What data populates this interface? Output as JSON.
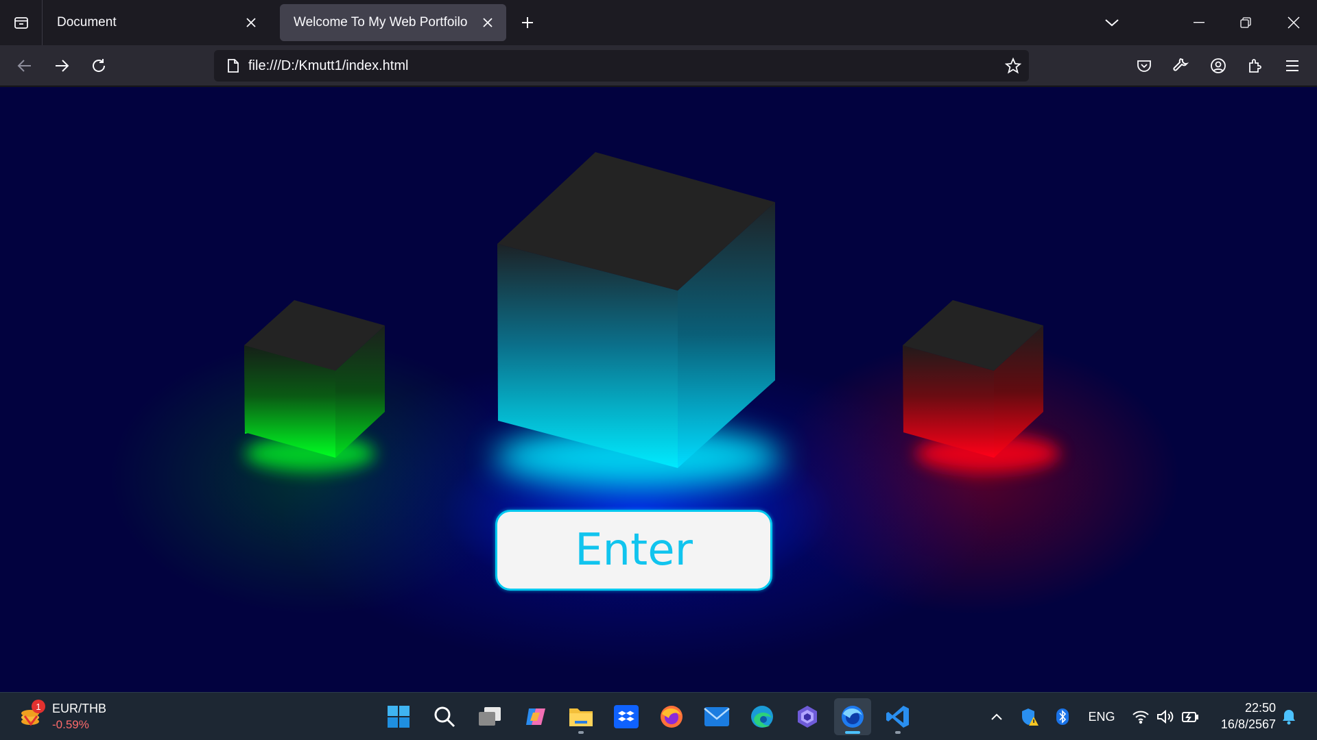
{
  "browser": {
    "tabs": [
      {
        "title": "Document",
        "active": false
      },
      {
        "title": "Welcome To My Web Portfoilo",
        "active": true
      }
    ],
    "url": "file:///D:/Kmutt1/index.html"
  },
  "page": {
    "enter_label": "Enter",
    "cubes": [
      {
        "name": "green-cube",
        "glow_color": "#00ff22"
      },
      {
        "name": "cyan-cube",
        "glow_color": "#00eaff"
      },
      {
        "name": "red-cube",
        "glow_color": "#ff0018"
      }
    ],
    "accent_color": "#00c8ef"
  },
  "taskbar": {
    "widget": {
      "title": "EUR/THB",
      "change": "-0.59%",
      "badge": "1"
    },
    "apps": [
      "start-icon",
      "search-icon",
      "task-view-icon",
      "copilot-icon",
      "file-explorer-icon",
      "dropbox-icon",
      "firefox-icon",
      "mail-icon",
      "edge-icon",
      "app-icon",
      "firefox-developer-icon",
      "vscode-icon"
    ],
    "language": "ENG",
    "time": "22:50",
    "date": "16/8/2567"
  }
}
